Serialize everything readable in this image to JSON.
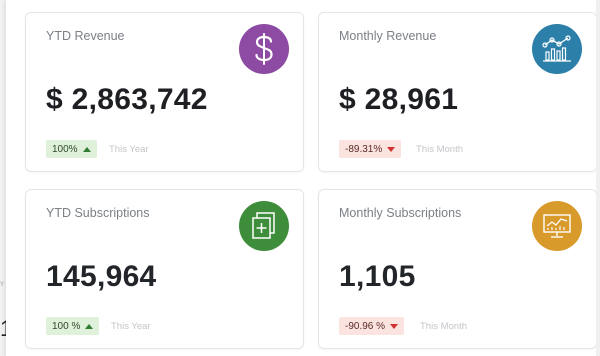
{
  "background": {
    "fragment_small": "Y",
    "fragment_large": "1"
  },
  "cards": [
    {
      "title": "YTD Revenue",
      "value": "$ 2,863,742",
      "change": "100%",
      "trend": "up",
      "period": "This Year",
      "icon": "dollar-icon",
      "icon_color": "#8e4ba3"
    },
    {
      "title": "Monthly Revenue",
      "value": "$ 28,961",
      "change": "-89.31%",
      "trend": "down",
      "period": "This Month",
      "icon": "bar-chart-icon",
      "icon_color": "#2b7fa8"
    },
    {
      "title": "YTD Subscriptions",
      "value": "145,964",
      "change": "100 %",
      "trend": "up",
      "period": "This Year",
      "icon": "copy-plus-icon",
      "icon_color": "#3e8d3a"
    },
    {
      "title": "Monthly Subscriptions",
      "value": "1,105",
      "change": "-90.96 %",
      "trend": "down",
      "period": "This Month",
      "icon": "monitor-chart-icon",
      "icon_color": "#d79a2b"
    }
  ],
  "colors": {
    "badge_up_bg": "#dff0db",
    "badge_down_bg": "#fbe3df",
    "arrow_up": "#2e7d32",
    "arrow_down": "#d32f2f"
  }
}
